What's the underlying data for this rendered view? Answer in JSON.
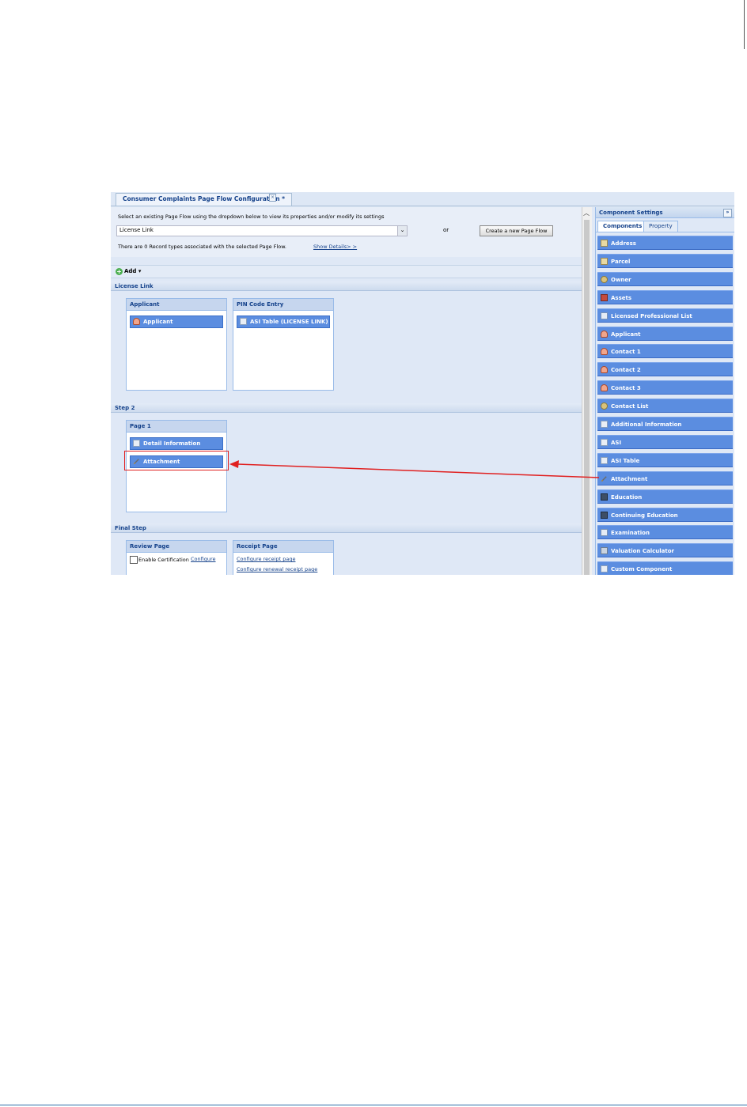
{
  "window": {
    "tab_title": "Consumer Complaints Page Flow Configuration *",
    "tab_close": "×"
  },
  "top": {
    "instruction": "Select an existing Page Flow using the dropdown below to view its properties and/or modify its settings",
    "select_value": "License Link",
    "select_arrow": "⌄",
    "or_text": "or",
    "create_button": "Create a new Page Flow",
    "records_text": "There are 0 Record types associated with the selected Page Flow.",
    "details_link": "Show Details> >"
  },
  "toolbar": {
    "add_label": "Add ▾",
    "add_icon": "+"
  },
  "sections": {
    "license_link": {
      "title": "License Link",
      "pages": [
        {
          "title": "Applicant",
          "components": [
            {
              "label": "Applicant",
              "icon": "person-icon"
            }
          ]
        },
        {
          "title": "PIN Code Entry",
          "components": [
            {
              "label": "ASI Table (LICENSE LINK)",
              "icon": "table-icon"
            }
          ]
        }
      ]
    },
    "step2": {
      "title": "Step 2",
      "pages": [
        {
          "title": "Page 1",
          "components": [
            {
              "label": "Detail Information",
              "icon": "table-icon"
            },
            {
              "label": "Attachment",
              "icon": "paperclip-icon"
            }
          ]
        }
      ]
    },
    "final_step": {
      "title": "Final Step",
      "review": {
        "title": "Review Page",
        "certification_label": "Enable Certification",
        "configure_link": "Configure"
      },
      "receipt": {
        "title": "Receipt Page",
        "link1": "Configure receipt page",
        "link2": "Configure renewal receipt page"
      }
    }
  },
  "right_panel": {
    "title": "Component Settings",
    "collapse": "»",
    "tabs": [
      "Components",
      "Property"
    ],
    "components": [
      {
        "label": "Address",
        "icon": "map-icon"
      },
      {
        "label": "Parcel",
        "icon": "map-icon"
      },
      {
        "label": "Owner",
        "icon": "owner-icon"
      },
      {
        "label": "Assets",
        "icon": "assets-icon"
      },
      {
        "label": "Licensed Professional List",
        "icon": "card-icon"
      },
      {
        "label": "Applicant",
        "icon": "person-icon"
      },
      {
        "label": "Contact 1",
        "icon": "contact-icon"
      },
      {
        "label": "Contact 2",
        "icon": "contact-icon"
      },
      {
        "label": "Contact 3",
        "icon": "contact-icon"
      },
      {
        "label": "Contact List",
        "icon": "contact-list-icon"
      },
      {
        "label": "Additional Information",
        "icon": "table-icon"
      },
      {
        "label": "ASI",
        "icon": "table-icon"
      },
      {
        "label": "ASI Table",
        "icon": "table-icon"
      },
      {
        "label": "Attachment",
        "icon": "paperclip-icon"
      },
      {
        "label": "Education",
        "icon": "book-icon"
      },
      {
        "label": "Continuing Education",
        "icon": "book-icon"
      },
      {
        "label": "Examination",
        "icon": "exam-icon"
      },
      {
        "label": "Valuation Calculator",
        "icon": "calculator-icon"
      },
      {
        "label": "Custom Component",
        "icon": "table-icon"
      }
    ]
  },
  "annotation": {
    "arrow_color": "#e02020"
  }
}
